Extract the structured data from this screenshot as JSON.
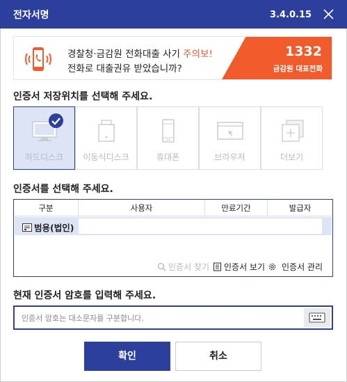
{
  "window": {
    "title": "전자서명",
    "version": "3.4.0.15",
    "close_icon": "close-x-icon"
  },
  "banner": {
    "warning_line_prefix": "경찰청·금감원 전화대출 사기 ",
    "warning_line_highlight": "주의보!",
    "question_line": "전화로 대출권유 받았습니까?",
    "hotline_number": "1332",
    "hotline_label": "금감원 대표전화",
    "accent_color": "#f15a2b",
    "icon": "ringing-phone-icon"
  },
  "storage": {
    "heading": "인증서 저장위치를 선택해 주세요.",
    "selected": "하드디스크",
    "items": [
      {
        "label": "하드디스크",
        "icon": "monitor-icon"
      },
      {
        "label": "이동식디스크",
        "icon": "usb-drive-icon"
      },
      {
        "label": "휴대폰",
        "icon": "mobile-phone-icon"
      },
      {
        "label": "브라우저",
        "icon": "browser-window-icon"
      },
      {
        "label": "더보기",
        "icon": "more-plus-icon"
      }
    ]
  },
  "certificates": {
    "heading": "인증서를 선택해 주세요.",
    "columns": [
      "구분",
      "사용자",
      "만료기간",
      "발급자"
    ],
    "rows": [
      {
        "type": "범용(법인)",
        "user": "",
        "expires": "",
        "issuer": ""
      }
    ],
    "actions": {
      "find": "인증서 찾기",
      "view": "인증서 보기",
      "manage": "인증서 관리"
    }
  },
  "password": {
    "heading": "현재 인증서 암호를 입력해 주세요.",
    "placeholder": "인증서 암호는 대소문자를 구분합니다.",
    "value": "",
    "keyboard_icon": "virtual-keyboard-icon"
  },
  "buttons": {
    "ok": "확인",
    "cancel": "취소"
  },
  "colors": {
    "primary": "#2d3f9c",
    "selected_bg": "#dde4f5",
    "warning": "#e4582f"
  }
}
